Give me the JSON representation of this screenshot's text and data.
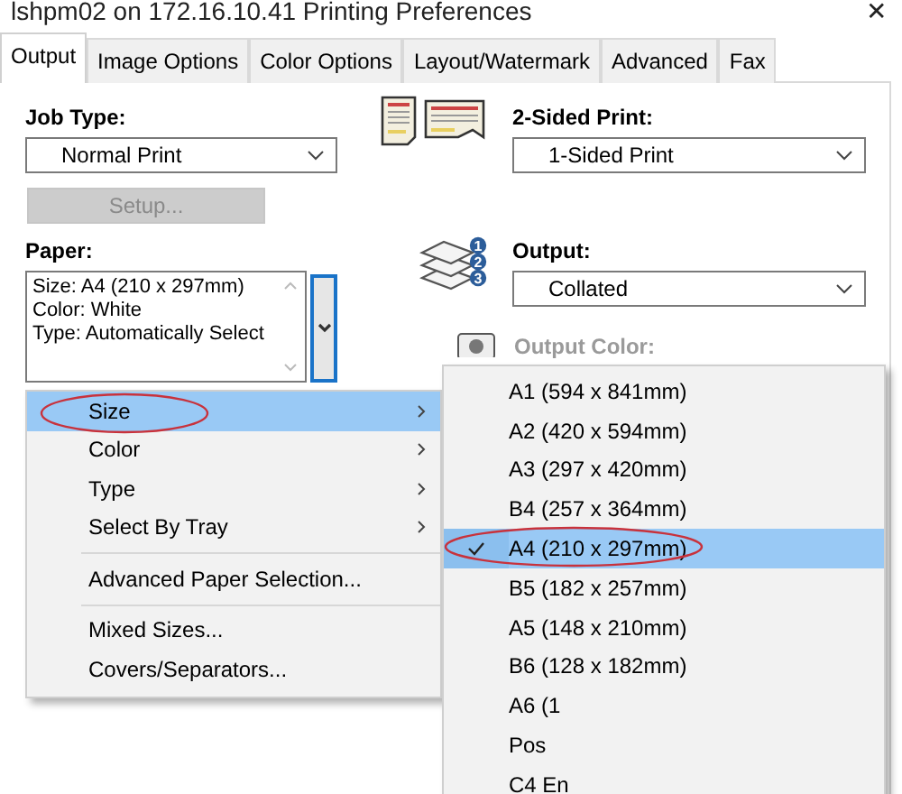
{
  "window": {
    "title": "lshpm02 on 172.16.10.41 Printing Preferences",
    "close": "✕"
  },
  "tabs": [
    {
      "label": "Output",
      "selected": true
    },
    {
      "label": "Image Options",
      "selected": false
    },
    {
      "label": "Color Options",
      "selected": false
    },
    {
      "label": "Layout/Watermark",
      "selected": false
    },
    {
      "label": "Advanced",
      "selected": false
    },
    {
      "label": "Fax",
      "selected": false
    }
  ],
  "job_type": {
    "label": "Job Type:",
    "value": "Normal Print"
  },
  "setup_button": {
    "label": "Setup...",
    "disabled": true
  },
  "two_sided": {
    "label": "2-Sided Print:",
    "value": "1-Sided Print"
  },
  "paper": {
    "label": "Paper:",
    "lines": [
      "Size: A4 (210 x 297mm)",
      "Color: White",
      "Type: Automatically Select"
    ]
  },
  "output": {
    "label": "Output:",
    "value": "Collated",
    "icon_numbers": [
      "1",
      "2",
      "3"
    ]
  },
  "output_color": {
    "label": "Output Color:",
    "disabled": true
  },
  "paper_menu": {
    "groups": [
      [
        {
          "label": "Size",
          "has_submenu": true,
          "selected": true
        },
        {
          "label": "Color",
          "has_submenu": true,
          "selected": false
        },
        {
          "label": "Type",
          "has_submenu": true,
          "selected": false
        },
        {
          "label": "Select By Tray",
          "has_submenu": true,
          "selected": false
        }
      ],
      [
        {
          "label": "Advanced Paper Selection...",
          "has_submenu": false,
          "selected": false
        }
      ],
      [
        {
          "label": "Mixed Sizes...",
          "has_submenu": false,
          "selected": false
        },
        {
          "label": "Covers/Separators...",
          "has_submenu": false,
          "selected": false
        }
      ]
    ]
  },
  "size_submenu": [
    {
      "label": "A1 (594 x 841mm)",
      "checked": false,
      "selected": false
    },
    {
      "label": "A2 (420 x 594mm)",
      "checked": false,
      "selected": false
    },
    {
      "label": "A3 (297 x 420mm)",
      "checked": false,
      "selected": false
    },
    {
      "label": "B4 (257 x 364mm)",
      "checked": false,
      "selected": false
    },
    {
      "label": "A4 (210 x 297mm)",
      "checked": true,
      "selected": true
    },
    {
      "label": "B5 (182 x 257mm)",
      "checked": false,
      "selected": false
    },
    {
      "label": "A5 (148 x 210mm)",
      "checked": false,
      "selected": false
    },
    {
      "label": "B6 (128 x 182mm)",
      "checked": false,
      "selected": false
    },
    {
      "label": "A6 (1",
      "checked": false,
      "selected": false
    },
    {
      "label": "Pos",
      "checked": false,
      "selected": false
    },
    {
      "label": "C4 En",
      "checked": false,
      "selected": false
    }
  ]
}
